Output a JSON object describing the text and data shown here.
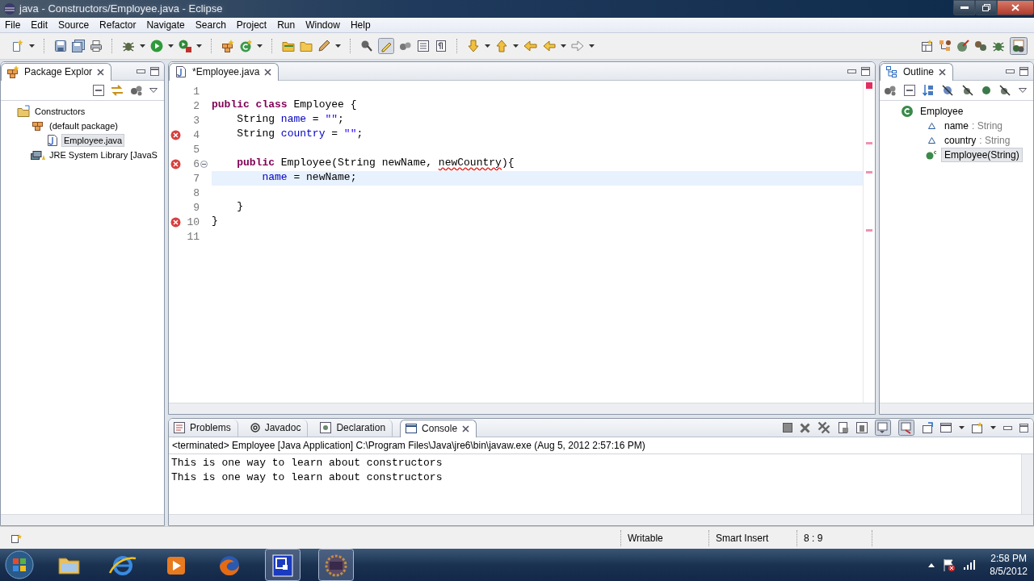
{
  "window": {
    "title": "java - Constructors/Employee.java - Eclipse"
  },
  "menu": [
    "File",
    "Edit",
    "Source",
    "Refactor",
    "Navigate",
    "Search",
    "Project",
    "Run",
    "Window",
    "Help"
  ],
  "package_explorer": {
    "tab": {
      "label": "Package Explor"
    },
    "tree": [
      {
        "label": "Constructors",
        "kind": "project",
        "selected": false,
        "children": [
          {
            "label": "(default package)",
            "kind": "package",
            "selected": false,
            "children": [
              {
                "label": "Employee.java",
                "kind": "file",
                "selected": true
              }
            ]
          },
          {
            "label": "JRE System Library [JavaS",
            "kind": "library",
            "selected": false
          }
        ]
      }
    ]
  },
  "editor": {
    "tab": {
      "label": "*Employee.java"
    },
    "lines": [
      {
        "number": "1",
        "error": false,
        "current": false
      },
      {
        "number": "2",
        "error": false,
        "current": false,
        "tokens": [
          {
            "text": "public class",
            "kind": "keyword"
          },
          {
            "text": " Employee {",
            "kind": "plain"
          }
        ]
      },
      {
        "number": "3",
        "error": false,
        "current": false,
        "tokens": [
          {
            "text": "    String ",
            "kind": "plain"
          },
          {
            "text": "name",
            "kind": "field"
          },
          {
            "text": " = ",
            "kind": "plain"
          },
          {
            "text": "\"\"",
            "kind": "string"
          },
          {
            "text": ";",
            "kind": "plain"
          }
        ]
      },
      {
        "number": "4",
        "error": true,
        "current": false,
        "tokens": [
          {
            "text": "    String ",
            "kind": "plain"
          },
          {
            "text": "country",
            "kind": "field"
          },
          {
            "text": " = ",
            "kind": "plain"
          },
          {
            "text": "\"\"",
            "kind": "string"
          },
          {
            "text": ";",
            "kind": "plain"
          }
        ]
      },
      {
        "number": "5",
        "error": false,
        "current": false
      },
      {
        "number": "6",
        "error": true,
        "current": false,
        "tokens": [
          {
            "text": "    public",
            "kind": "keyword"
          },
          {
            "text": " Employee(String newName, ",
            "kind": "plain"
          },
          {
            "text": "newCountry",
            "kind": "error"
          },
          {
            "text": "){",
            "kind": "plain"
          }
        ]
      },
      {
        "number": "7",
        "error": false,
        "current": true,
        "tokens": [
          {
            "text": "        name",
            "kind": "field"
          },
          {
            "text": " = newName;",
            "kind": "plain"
          }
        ]
      },
      {
        "number": "8",
        "error": false,
        "current": false
      },
      {
        "number": "9",
        "error": false,
        "current": false,
        "tokens": [
          {
            "text": "    }",
            "kind": "plain"
          }
        ]
      },
      {
        "number": "10",
        "error": true,
        "current": false,
        "tokens": [
          {
            "text": "}",
            "kind": "plain"
          }
        ]
      },
      {
        "number": "11",
        "error": false,
        "current": false
      }
    ]
  },
  "outline": {
    "tab": {
      "label": "Outline"
    },
    "tree": [
      {
        "label": "Employee",
        "kind": "class",
        "selected": false,
        "children": [
          {
            "label": "name",
            "type": ": String",
            "kind": "field",
            "selected": false
          },
          {
            "label": "country",
            "type": ": String",
            "kind": "field",
            "selected": false
          },
          {
            "label": "Employee(String)",
            "kind": "constructor",
            "selected": true
          }
        ]
      }
    ]
  },
  "bottom_tabs": [
    {
      "label": "Problems",
      "kind": "problems",
      "selected": false
    },
    {
      "label": "Javadoc",
      "kind": "javadoc",
      "selected": false
    },
    {
      "label": "Declaration",
      "kind": "declaration",
      "selected": false
    },
    {
      "label": "Console",
      "kind": "console",
      "selected": true
    }
  ],
  "console": {
    "header": "<terminated> Employee [Java Application] C:\\Program Files\\Java\\jre6\\bin\\javaw.exe (Aug 5, 2012 2:57:16 PM)",
    "output": [
      "This is one way to learn about constructors",
      "This is one way to learn about constructors"
    ]
  },
  "status_bar": [
    "Writable",
    "Smart Insert",
    "8 : 9"
  ],
  "taskbar": {
    "apps": [
      {
        "kind": "explorer",
        "active": false
      },
      {
        "kind": "browser",
        "active": false
      },
      {
        "kind": "media",
        "active": false
      },
      {
        "kind": "firefox",
        "active": false
      },
      {
        "kind": "window",
        "active": true
      },
      {
        "kind": "eclipse",
        "active": true
      }
    ],
    "clock": {
      "time": "2:58 PM",
      "date": "8/5/2012"
    }
  }
}
